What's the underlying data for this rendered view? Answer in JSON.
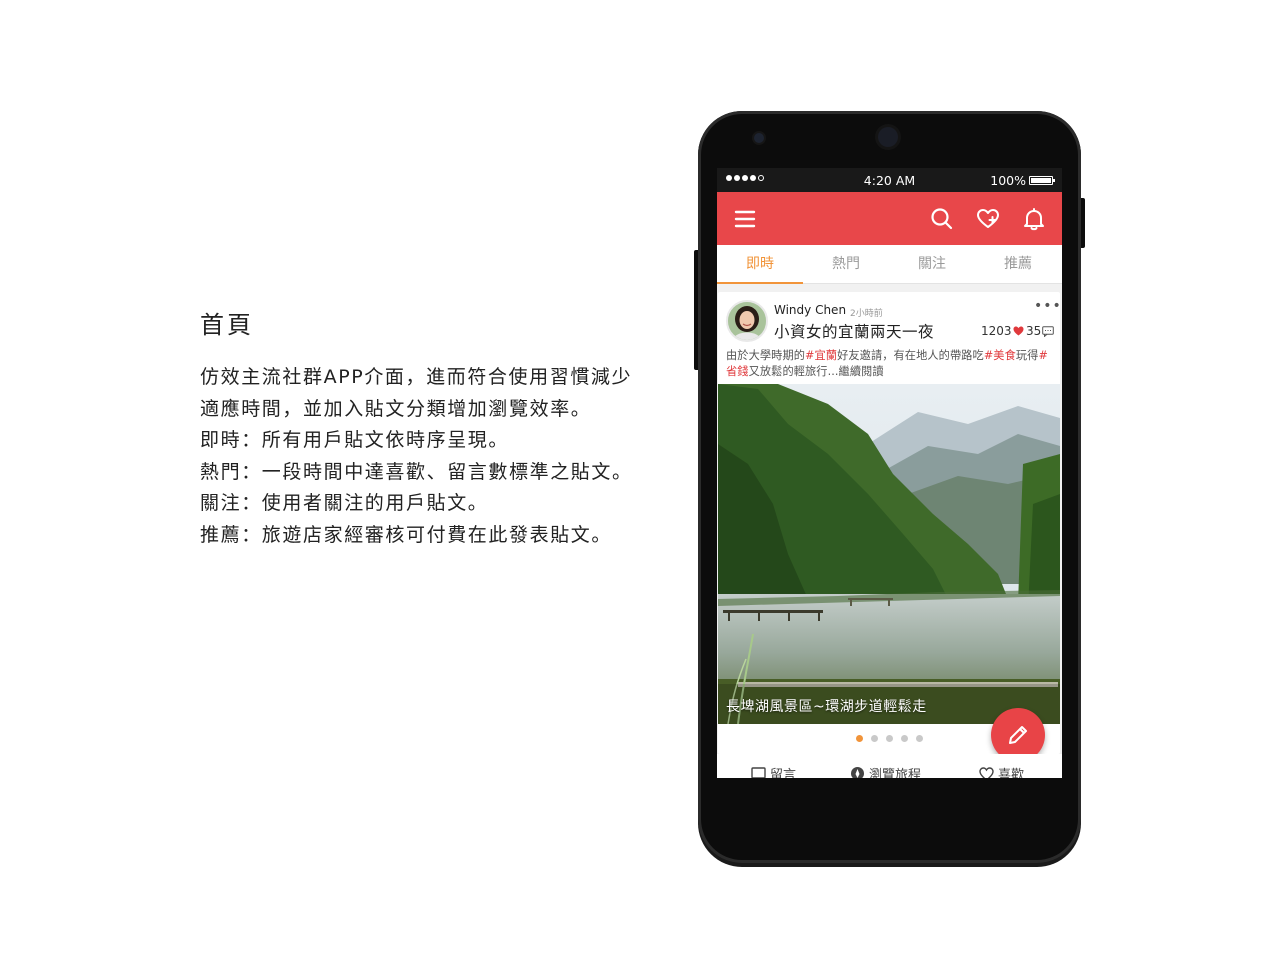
{
  "description": {
    "title": "首頁",
    "lines": [
      "仿效主流社群APP介面，進而符合使用習慣減少",
      "適應時間，並加入貼文分類增加瀏覽效率。",
      "即時：所有用戶貼文依時序呈現。",
      "熱門：一段時間中達喜歡、留言數標準之貼文。",
      "關注：使用者關注的用戶貼文。",
      "推薦：旅遊店家經審核可付費在此發表貼文。"
    ]
  },
  "status_bar": {
    "time": "4:20 AM",
    "battery": "100%"
  },
  "app_bar": {
    "color": "#e8474a",
    "icons": [
      "menu-icon",
      "search-icon",
      "heart-add-icon",
      "bell-icon"
    ]
  },
  "tabs": [
    {
      "label": "即時",
      "active": true
    },
    {
      "label": "熱門",
      "active": false
    },
    {
      "label": "關注",
      "active": false
    },
    {
      "label": "推薦",
      "active": false
    }
  ],
  "accent_color": "#f1943a",
  "post": {
    "author": "Windy Chen",
    "time_ago": "2小時前",
    "title": "小資女的宜蘭兩天一夜",
    "likes": "1203",
    "comments": "35",
    "excerpt": {
      "p1": "由於大學時期的",
      "tag1": "#宜蘭",
      "p2": "好友邀請，有在地人的帶路吃",
      "tag2": "#美食",
      "p3": "玩得",
      "tag3": "#省錢",
      "p4": "又放鬆的輕旅行...繼續閱讀"
    },
    "photo_caption": "長埤湖風景區~環湖步道輕鬆走",
    "carousel": {
      "total": 5,
      "current": 1
    }
  },
  "actions": {
    "comment": "留言",
    "trip": "瀏覽旅程",
    "like": "喜歡"
  }
}
